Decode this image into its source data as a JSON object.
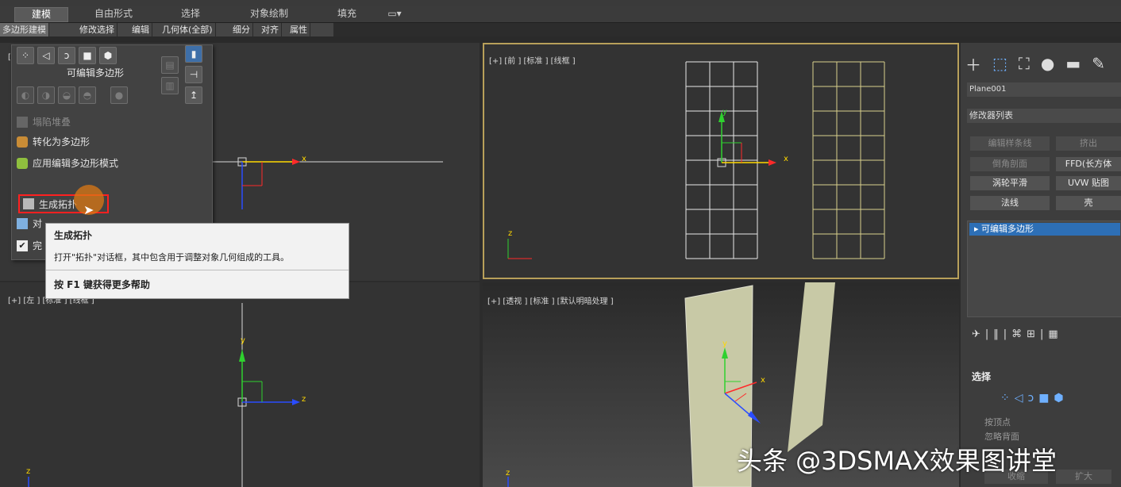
{
  "ribbon": {
    "tabs": [
      "建模",
      "自由形式",
      "选择",
      "对象绘制",
      "填充"
    ],
    "subtabs": [
      "多边形建模",
      "修改选择",
      "编辑",
      "几何体(全部)",
      "细分",
      "对齐",
      "属性"
    ]
  },
  "panel": {
    "title": "可编辑多边形",
    "items": [
      {
        "label": "塌陷堆叠",
        "icon": "collapse-icon",
        "enabled": false
      },
      {
        "label": "转化为多边形",
        "icon": "convert-icon",
        "enabled": true
      },
      {
        "label": "应用编辑多边形模式",
        "icon": "apply-icon",
        "enabled": true
      },
      {
        "label": "生成拓扑",
        "icon": "topology-icon",
        "enabled": true,
        "highlighted": true
      },
      {
        "label": "对",
        "icon": "symmetry-icon",
        "enabled": true
      },
      {
        "label": "完",
        "icon": "checkbox-icon",
        "enabled": true
      }
    ]
  },
  "tooltip": {
    "title": "生成拓扑",
    "description": "打开\"拓扑\"对话框，其中包含用于调整对象几何组成的工具。",
    "help": "按 F1 键获得更多帮助"
  },
  "viewports": {
    "top_left_label": "[",
    "front_label": "[+] [前 ] [标准 ] [线框 ]",
    "left_label": "[+] [左 ] [标准 ] [线框 ]",
    "perspective_label": "[+] [透视 ] [标准 ] [默认明暗处理 ]",
    "axis": {
      "x": "x",
      "y": "y",
      "z": "z"
    }
  },
  "command_panel": {
    "object_name": "Plane001",
    "modifier_list": "修改器列表",
    "buttons": [
      "编辑样条线",
      "挤出",
      "倒角剖面",
      "FFD(长方体",
      "涡轮平滑",
      "UVW 贴图",
      "法线",
      "壳"
    ],
    "stack_item": "可编辑多边形",
    "selection_title": "选择",
    "by_vertex": "按顶点",
    "ignore_backface": "忽略背面",
    "shrink": "收缩",
    "grow": "扩大"
  },
  "watermark": "头条 @3DSMAX效果图讲堂",
  "colors": {
    "viewport_bg": "#333333",
    "front_border": "#b8a05a",
    "grid_white": "#e8e8e8",
    "grid_yellow": "#d9d08c",
    "axis_x": "#ff2a2a",
    "axis_y": "#2fd12f",
    "axis_z": "#2a4cff",
    "highlight_red": "#ff2020",
    "selection_blue": "#2d6fb6",
    "plane_fill": "#c8c9a6"
  }
}
